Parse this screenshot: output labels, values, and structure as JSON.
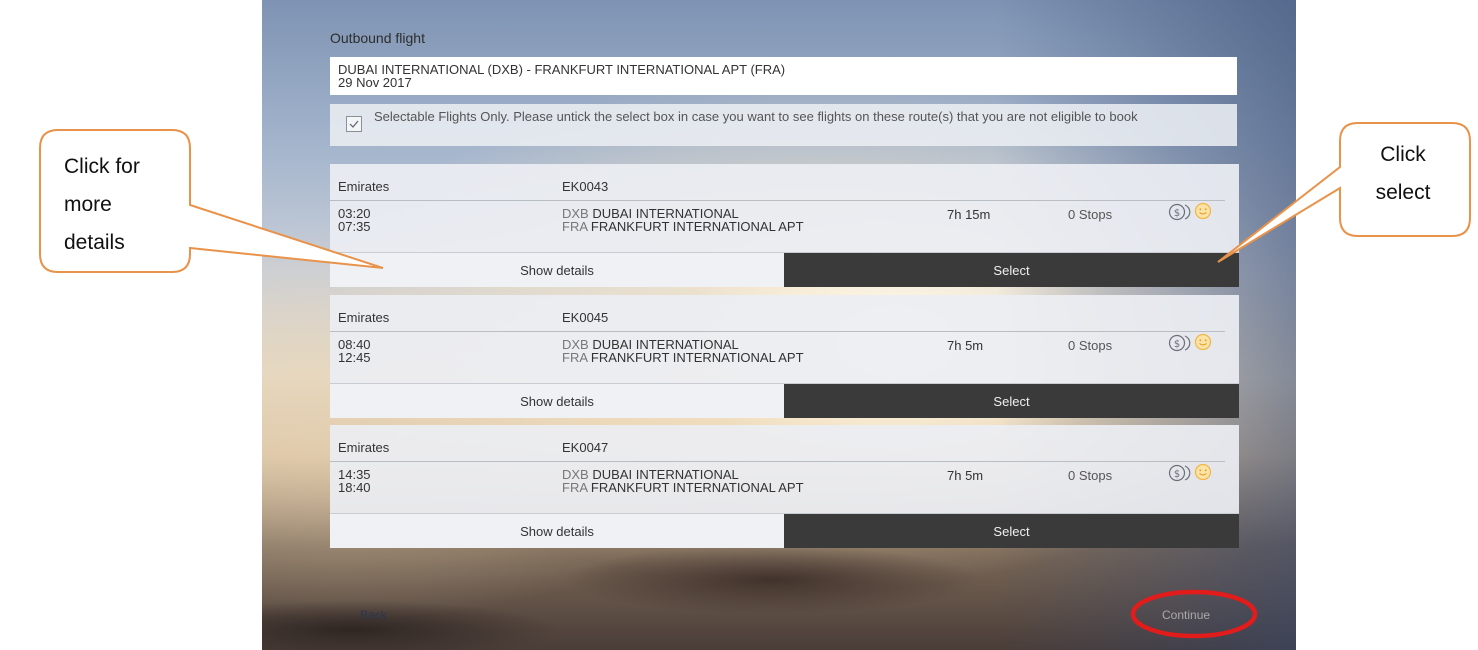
{
  "page": {
    "outbound_title": "Outbound flight",
    "route": "DUBAI INTERNATIONAL (DXB) - FRANKFURT INTERNATIONAL APT (FRA)",
    "date": "29 Nov 2017",
    "filter_text": "Selectable Flights Only. Please untick the select box in case you want to see flights on these route(s) that you are not eligible to book",
    "filter_checked": true,
    "back_label": "Back",
    "continue_label": "Continue"
  },
  "flights": [
    {
      "airline": "Emirates",
      "number": "EK0043",
      "depart": "03:20",
      "arrive": "07:35",
      "from_code": "DXB",
      "from_name": "DUBAI INTERNATIONAL",
      "to_code": "FRA",
      "to_name": "FRANKFURT INTERNATIONAL APT",
      "duration": "7h 15m",
      "stops": "0 Stops",
      "details_label": "Show details",
      "select_label": "Select"
    },
    {
      "airline": "Emirates",
      "number": "EK0045",
      "depart": "08:40",
      "arrive": "12:45",
      "from_code": "DXB",
      "from_name": "DUBAI INTERNATIONAL",
      "to_code": "FRA",
      "to_name": "FRANKFURT INTERNATIONAL APT",
      "duration": "7h 5m",
      "stops": "0 Stops",
      "details_label": "Show details",
      "select_label": "Select"
    },
    {
      "airline": "Emirates",
      "number": "EK0047",
      "depart": "14:35",
      "arrive": "18:40",
      "from_code": "DXB",
      "from_name": "DUBAI INTERNATIONAL",
      "to_code": "FRA",
      "to_name": "FRANKFURT INTERNATIONAL APT",
      "duration": "7h 5m",
      "stops": "0 Stops",
      "details_label": "Show details",
      "select_label": "Select"
    }
  ],
  "annotations": {
    "left_callout_lines": [
      "Click for",
      "more",
      "details"
    ],
    "right_callout_lines": [
      "Click",
      "select"
    ]
  },
  "icons": {
    "fare": "dollar-coins-icon",
    "rating": "smiley-icon",
    "checkbox": "check-icon"
  },
  "colors": {
    "select_button": "#3a3a3b",
    "callout_border": "#e8924a",
    "highlight_ellipse": "#e21b1b",
    "smiley": "#f2b640"
  }
}
